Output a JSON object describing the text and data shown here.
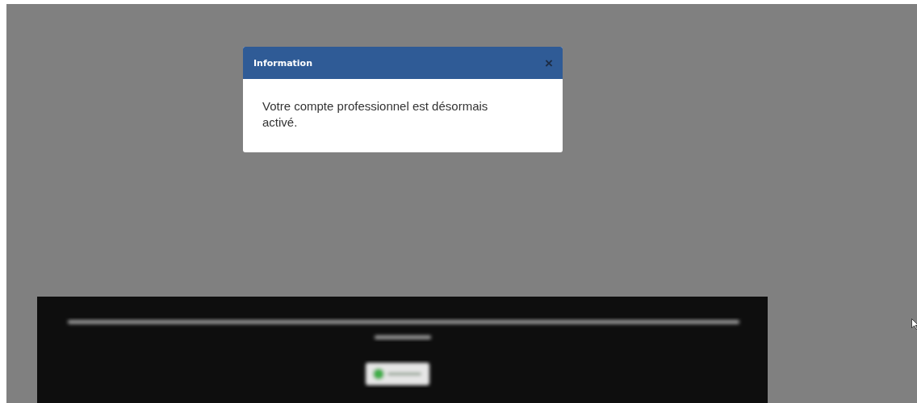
{
  "dialog": {
    "title": "Information",
    "close": "×",
    "message": "Votre compte professionnel est désormais activé."
  }
}
